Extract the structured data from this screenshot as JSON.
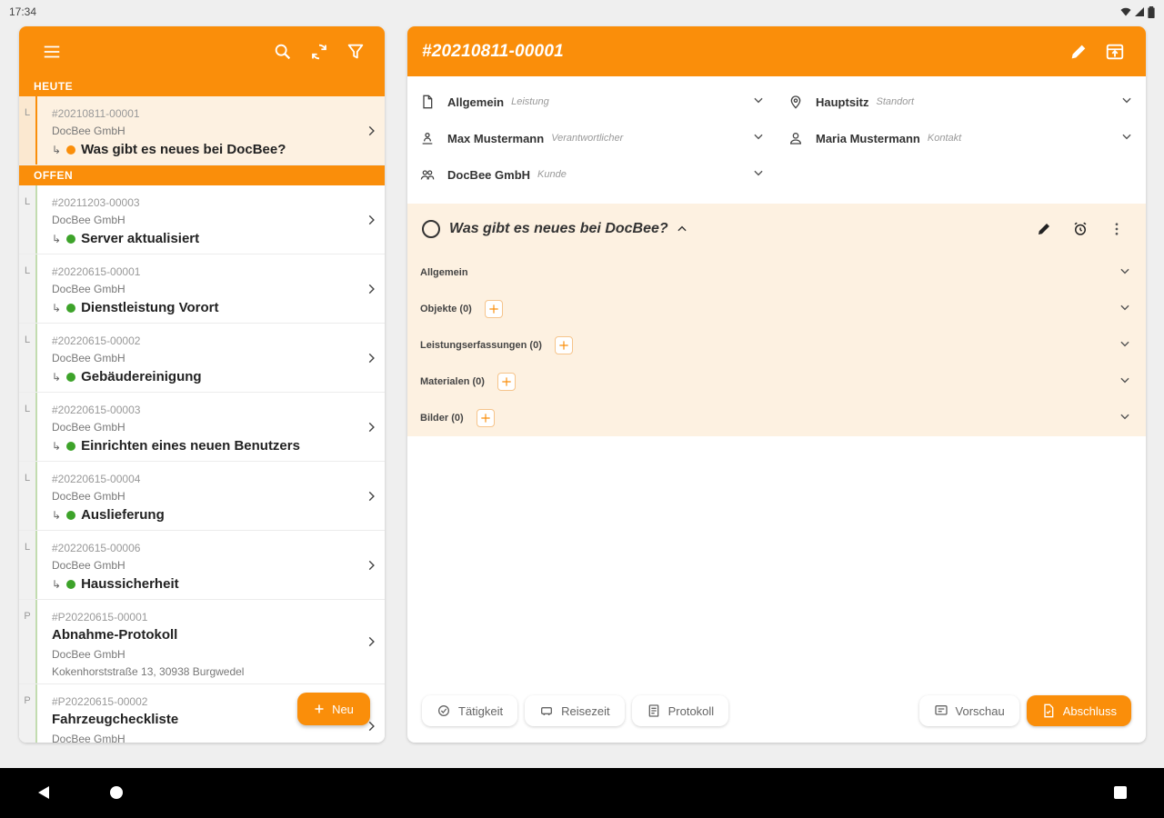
{
  "status_bar": {
    "time": "17:34"
  },
  "list_panel": {
    "sections": [
      {
        "header": "HEUTE",
        "items": [
          {
            "type": "L",
            "id": "#20210811-00001",
            "company": "DocBee GmbH",
            "title": "Was gibt es neues bei DocBee?",
            "status": "orange",
            "selected": true
          }
        ]
      },
      {
        "header": "OFFEN",
        "items": [
          {
            "type": "L",
            "id": "#20211203-00003",
            "company": "DocBee GmbH",
            "title": "Server aktualisiert",
            "status": "green"
          },
          {
            "type": "L",
            "id": "#20220615-00001",
            "company": "DocBee GmbH",
            "title": "Dienstleistung Vorort",
            "status": "green"
          },
          {
            "type": "L",
            "id": "#20220615-00002",
            "company": "DocBee GmbH",
            "title": "Gebäudereinigung",
            "status": "green"
          },
          {
            "type": "L",
            "id": "#20220615-00003",
            "company": "DocBee GmbH",
            "title": "Einrichten eines neuen Benutzers",
            "status": "green"
          },
          {
            "type": "L",
            "id": "#20220615-00004",
            "company": "DocBee GmbH",
            "title": "Auslieferung",
            "status": "green"
          },
          {
            "type": "L",
            "id": "#20220615-00006",
            "company": "DocBee GmbH",
            "title": "Haussicherheit",
            "status": "green"
          },
          {
            "type": "P",
            "id": "#P20220615-00001",
            "title": "Abnahme-Protokoll",
            "company": "DocBee GmbH",
            "address": "Kokenhorststraße 13, 30938 Burgwedel",
            "protocol": true
          },
          {
            "type": "P",
            "id": "#P20220615-00002",
            "title": "Fahrzeugcheckliste",
            "company": "DocBee GmbH",
            "address": "",
            "protocol": true
          }
        ]
      }
    ],
    "fab_label": "Neu"
  },
  "detail": {
    "title": "#20210811-00001",
    "fields": {
      "general": {
        "value": "Allgemein",
        "label": "Leistung"
      },
      "location": {
        "value": "Hauptsitz",
        "label": "Standort"
      },
      "responsible": {
        "value": "Max Mustermann",
        "label": "Verantwortlicher"
      },
      "contact": {
        "value": "Maria Mustermann",
        "label": "Kontakt"
      },
      "customer": {
        "value": "DocBee GmbH",
        "label": "Kunde"
      }
    },
    "task": {
      "title": "Was gibt es neues bei DocBee?",
      "sections": {
        "general": "Allgemein",
        "objects": "Objekte (0)",
        "services": "Leistungserfassungen (0)",
        "materials": "Materialen (0)",
        "images": "Bilder (0)"
      }
    },
    "actions": {
      "activity": "Tätigkeit",
      "travel": "Reisezeit",
      "protocol": "Protokoll",
      "preview": "Vorschau",
      "finish": "Abschluss"
    }
  },
  "colors": {
    "accent": "#fa8e0a",
    "status_green": "#3da32a",
    "selected_bg": "#fdf1e1"
  },
  "icons": [
    "menu-icon",
    "search-icon",
    "sync-icon",
    "filter-icon",
    "edit-icon",
    "export-icon",
    "document-icon",
    "location-icon",
    "person-pin-icon",
    "contact-icon",
    "group-icon",
    "alarm-icon",
    "more-vert-icon",
    "plus-icon",
    "activity-icon",
    "travel-icon",
    "protocol-icon",
    "preview-icon",
    "finish-icon"
  ]
}
